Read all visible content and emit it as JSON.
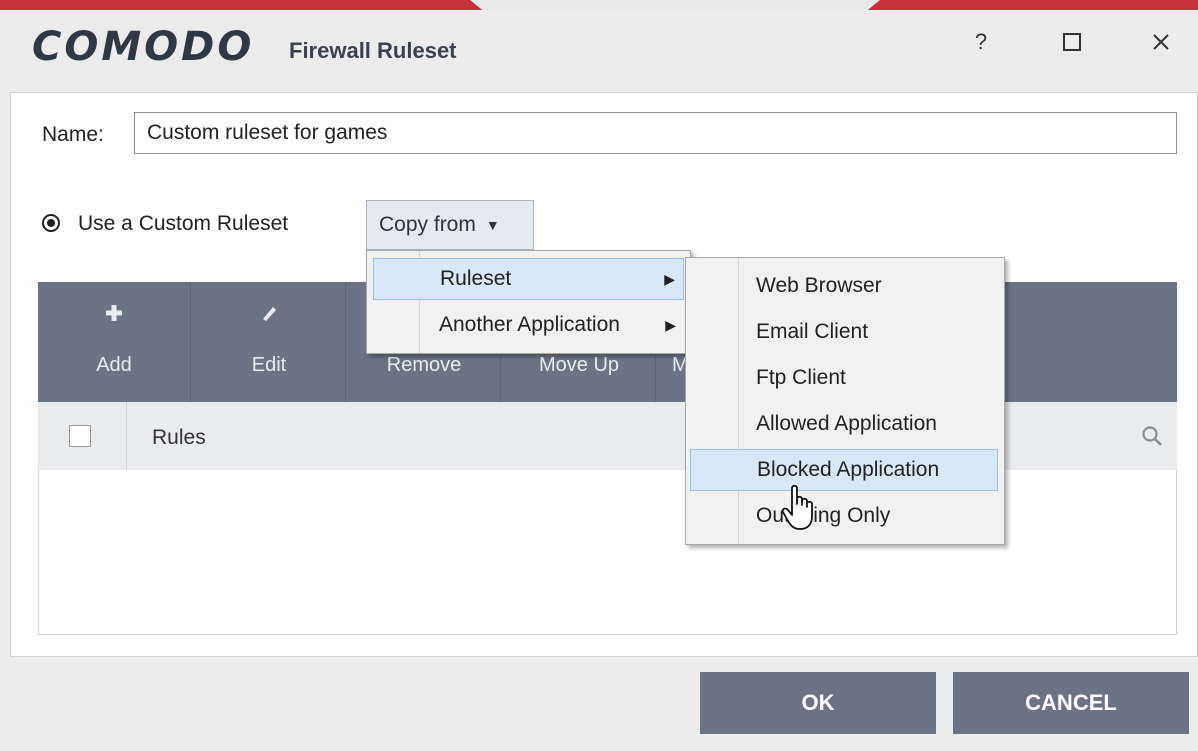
{
  "window": {
    "logo": "COMODO",
    "title": "Firewall Ruleset",
    "help_label": "?",
    "maximize_label": "☐",
    "close_label": "✕"
  },
  "name_field": {
    "label": "Name:",
    "value": "Custom ruleset for games"
  },
  "ruleset_option": {
    "label": "Use a Custom Ruleset",
    "selected": true,
    "copy_from_label": "Copy from",
    "copy_from_caret": "▼"
  },
  "toolbar": {
    "items": [
      {
        "label": "Add",
        "icon": "plus-icon"
      },
      {
        "label": "Edit",
        "icon": "pencil-icon"
      },
      {
        "label": "Remove",
        "icon": "remove-icon"
      },
      {
        "label": "Move Up",
        "icon": "arrow-up-icon"
      },
      {
        "label": "M",
        "icon": "arrow-down-icon"
      }
    ]
  },
  "list": {
    "header": "Rules"
  },
  "copy_menu": {
    "items": [
      {
        "label": "Ruleset",
        "arrow": "▶",
        "highlighted": true
      },
      {
        "label": "Another Application",
        "arrow": "▶",
        "highlighted": false
      }
    ]
  },
  "ruleset_submenu": {
    "items": [
      {
        "label": "Web Browser"
      },
      {
        "label": "Email Client"
      },
      {
        "label": "Ftp Client"
      },
      {
        "label": "Allowed Application"
      },
      {
        "label": "Blocked Application",
        "highlighted": true
      },
      {
        "label": "Outgoing Only"
      }
    ]
  },
  "buttons": {
    "ok": "OK",
    "cancel": "CANCEL"
  },
  "colors": {
    "brand_red": "#c9313a",
    "toolbar": "#6a7485",
    "highlight": "#d9e8f6"
  }
}
